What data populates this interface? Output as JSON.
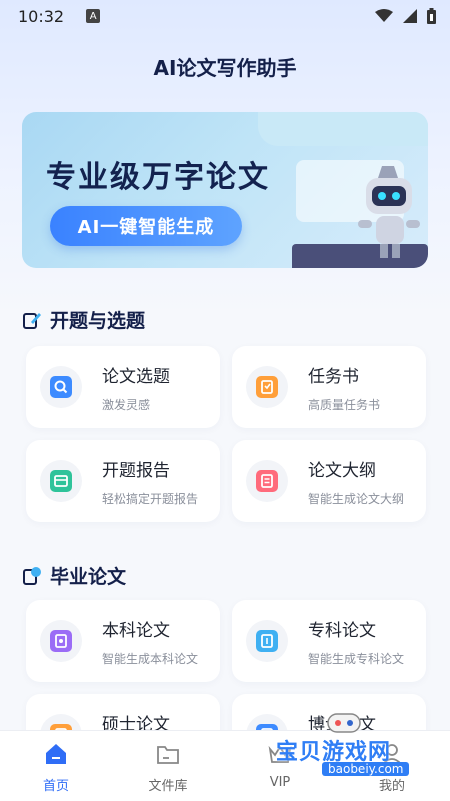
{
  "status": {
    "time": "10:32",
    "badge": "A"
  },
  "app": {
    "title": "AI论文写作助手"
  },
  "banner": {
    "headline": "专业级万字论文",
    "pill": "AI一键智能生成"
  },
  "sections": [
    {
      "title": "开题与选题",
      "cards": [
        {
          "title": "论文选题",
          "subtitle": "激发灵感",
          "icon": "search-icon",
          "color": "#3d8bff"
        },
        {
          "title": "任务书",
          "subtitle": "高质量任务书",
          "icon": "task-icon",
          "color": "#ff9f3a"
        },
        {
          "title": "开题报告",
          "subtitle": "轻松搞定开题报告",
          "icon": "report-icon",
          "color": "#2fc39a"
        },
        {
          "title": "论文大纲",
          "subtitle": "智能生成论文大纲",
          "icon": "outline-icon",
          "color": "#ff6b7c"
        }
      ]
    },
    {
      "title": "毕业论文",
      "cards": [
        {
          "title": "本科论文",
          "subtitle": "智能生成本科论文",
          "icon": "bachelor-icon",
          "color": "#9b6cf6"
        },
        {
          "title": "专科论文",
          "subtitle": "智能生成专科论文",
          "icon": "college-icon",
          "color": "#3fb0f2"
        },
        {
          "title": "硕士论文",
          "subtitle": "",
          "icon": "master-icon",
          "color": "#ff9f3a"
        },
        {
          "title": "博士论文",
          "subtitle": "",
          "icon": "doctor-icon",
          "color": "#3d8bff"
        }
      ]
    }
  ],
  "tabs": [
    {
      "label": "首页",
      "icon": "home-icon",
      "active": true
    },
    {
      "label": "文件库",
      "icon": "folder-icon",
      "active": false
    },
    {
      "label": "VIP",
      "icon": "vip-icon",
      "active": false
    },
    {
      "label": "我的",
      "icon": "profile-icon",
      "active": false
    }
  ],
  "watermark": {
    "text": "宝贝游戏网",
    "url": "baobeiy.com"
  },
  "colors": {
    "accent": "#2f6df6",
    "title": "#14204a"
  }
}
